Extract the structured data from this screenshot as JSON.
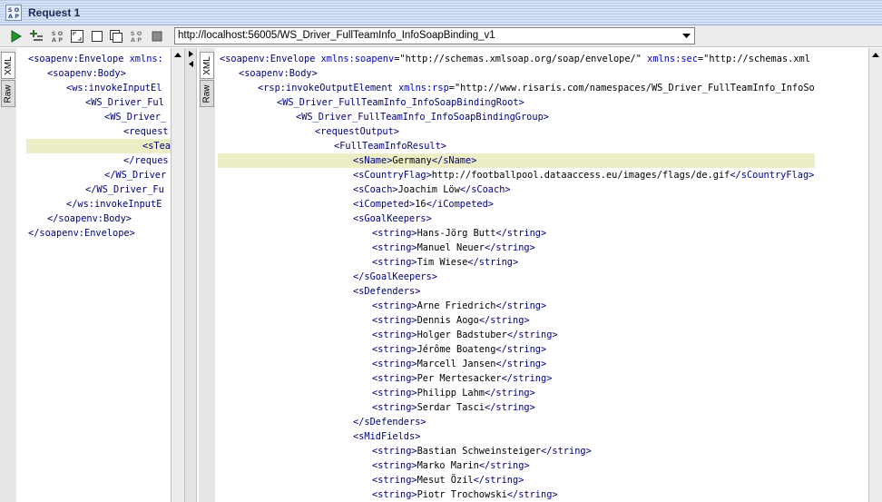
{
  "window": {
    "title": "Request 1",
    "title_icon": "soap-icon"
  },
  "toolbar": {
    "buttons": [
      "run-icon",
      "add-assertion-icon",
      "soap-icon",
      "fullscreen-icon",
      "split-horizontal-icon",
      "split-window-icon",
      "soap-icon",
      "stop-icon"
    ],
    "endpoint": "http://localhost:56005/WS_Driver_FullTeamInfo_InfoSoapBinding_v1"
  },
  "request_panel": {
    "tabs": [
      "XML",
      "Raw"
    ],
    "active_tab": "XML",
    "lines": [
      {
        "indent": 0,
        "parts": [
          {
            "c": "tag",
            "t": "<soapenv:Envelope "
          },
          {
            "c": "attr",
            "t": "xmlns:"
          }
        ]
      },
      {
        "indent": 1,
        "parts": [
          {
            "c": "tag",
            "t": "<soapenv:Body>"
          }
        ]
      },
      {
        "indent": 2,
        "parts": [
          {
            "c": "tag",
            "t": "<ws:invokeInputEl"
          }
        ]
      },
      {
        "indent": 3,
        "parts": [
          {
            "c": "tag",
            "t": "<WS_Driver_Ful"
          }
        ]
      },
      {
        "indent": 4,
        "parts": [
          {
            "c": "tag",
            "t": "<WS_Driver_"
          }
        ]
      },
      {
        "indent": 5,
        "parts": [
          {
            "c": "tag",
            "t": "<request"
          }
        ]
      },
      {
        "indent": 6,
        "hl": true,
        "parts": [
          {
            "c": "tag",
            "t": "<sTea"
          }
        ]
      },
      {
        "indent": 5,
        "parts": [
          {
            "c": "tag",
            "t": "</reques"
          }
        ]
      },
      {
        "indent": 4,
        "parts": [
          {
            "c": "tag",
            "t": "</WS_Driver"
          }
        ]
      },
      {
        "indent": 3,
        "parts": [
          {
            "c": "tag",
            "t": "</WS_Driver_Fu"
          }
        ]
      },
      {
        "indent": 2,
        "parts": [
          {
            "c": "tag",
            "t": "</ws:invokeInputE"
          }
        ]
      },
      {
        "indent": 1,
        "parts": [
          {
            "c": "tag",
            "t": "</soapenv:Body>"
          }
        ]
      },
      {
        "indent": 0,
        "parts": [
          {
            "c": "tag",
            "t": "</soapenv:Envelope>"
          }
        ]
      }
    ]
  },
  "response_panel": {
    "tabs": [
      "XML",
      "Raw"
    ],
    "active_tab": "XML",
    "lines": [
      {
        "indent": 0,
        "parts": [
          {
            "c": "tag",
            "t": "<soapenv:Envelope "
          },
          {
            "c": "attr",
            "t": "xmlns:soapenv"
          },
          {
            "c": "val",
            "t": "=\"http://schemas.xmlsoap.org/soap/envelope/\" "
          },
          {
            "c": "attr",
            "t": "xmlns:sec"
          },
          {
            "c": "val",
            "t": "=\"http://schemas.xml"
          }
        ]
      },
      {
        "indent": 1,
        "parts": [
          {
            "c": "tag",
            "t": "<soapenv:Body>"
          }
        ]
      },
      {
        "indent": 2,
        "parts": [
          {
            "c": "tag",
            "t": "<rsp:invokeOutputElement "
          },
          {
            "c": "attr",
            "t": "xmlns:rsp"
          },
          {
            "c": "val",
            "t": "=\"http://www.risaris.com/namespaces/WS_Driver_FullTeamInfo_InfoSo"
          }
        ]
      },
      {
        "indent": 3,
        "parts": [
          {
            "c": "tag",
            "t": "<WS_Driver_FullTeamInfo_InfoSoapBindingRoot>"
          }
        ]
      },
      {
        "indent": 4,
        "parts": [
          {
            "c": "tag",
            "t": "<WS_Driver_FullTeamInfo_InfoSoapBindingGroup>"
          }
        ]
      },
      {
        "indent": 5,
        "parts": [
          {
            "c": "tag",
            "t": "<requestOutput>"
          }
        ]
      },
      {
        "indent": 6,
        "parts": [
          {
            "c": "tag",
            "t": "<FullTeamInfoResult>"
          }
        ]
      },
      {
        "indent": 7,
        "hl": true,
        "parts": [
          {
            "c": "tag",
            "t": "<sName>"
          },
          {
            "c": "txt",
            "t": "Germany"
          },
          {
            "c": "tag",
            "t": "</sName>"
          }
        ]
      },
      {
        "indent": 7,
        "parts": [
          {
            "c": "tag",
            "t": "<sCountryFlag>"
          },
          {
            "c": "txt",
            "t": "http://footballpool.dataaccess.eu/images/flags/de.gif"
          },
          {
            "c": "tag",
            "t": "</sCountryFlag>"
          }
        ]
      },
      {
        "indent": 7,
        "parts": [
          {
            "c": "tag",
            "t": "<sCoach>"
          },
          {
            "c": "txt",
            "t": "Joachim Löw"
          },
          {
            "c": "tag",
            "t": "</sCoach>"
          }
        ]
      },
      {
        "indent": 7,
        "parts": [
          {
            "c": "tag",
            "t": "<iCompeted>"
          },
          {
            "c": "txt",
            "t": "16"
          },
          {
            "c": "tag",
            "t": "</iCompeted>"
          }
        ]
      },
      {
        "indent": 7,
        "parts": [
          {
            "c": "tag",
            "t": "<sGoalKeepers>"
          }
        ]
      },
      {
        "indent": 8,
        "parts": [
          {
            "c": "tag",
            "t": "<string>"
          },
          {
            "c": "txt",
            "t": "Hans-Jörg Butt"
          },
          {
            "c": "tag",
            "t": "</string>"
          }
        ]
      },
      {
        "indent": 8,
        "parts": [
          {
            "c": "tag",
            "t": "<string>"
          },
          {
            "c": "txt",
            "t": "Manuel Neuer"
          },
          {
            "c": "tag",
            "t": "</string>"
          }
        ]
      },
      {
        "indent": 8,
        "parts": [
          {
            "c": "tag",
            "t": "<string>"
          },
          {
            "c": "txt",
            "t": "Tim Wiese"
          },
          {
            "c": "tag",
            "t": "</string>"
          }
        ]
      },
      {
        "indent": 7,
        "parts": [
          {
            "c": "tag",
            "t": "</sGoalKeepers>"
          }
        ]
      },
      {
        "indent": 7,
        "parts": [
          {
            "c": "tag",
            "t": "<sDefenders>"
          }
        ]
      },
      {
        "indent": 8,
        "parts": [
          {
            "c": "tag",
            "t": "<string>"
          },
          {
            "c": "txt",
            "t": "Arne Friedrich"
          },
          {
            "c": "tag",
            "t": "</string>"
          }
        ]
      },
      {
        "indent": 8,
        "parts": [
          {
            "c": "tag",
            "t": "<string>"
          },
          {
            "c": "txt",
            "t": "Dennis Aogo"
          },
          {
            "c": "tag",
            "t": "</string>"
          }
        ]
      },
      {
        "indent": 8,
        "parts": [
          {
            "c": "tag",
            "t": "<string>"
          },
          {
            "c": "txt",
            "t": "Holger Badstuber"
          },
          {
            "c": "tag",
            "t": "</string>"
          }
        ]
      },
      {
        "indent": 8,
        "parts": [
          {
            "c": "tag",
            "t": "<string>"
          },
          {
            "c": "txt",
            "t": "Jérôme Boateng"
          },
          {
            "c": "tag",
            "t": "</string>"
          }
        ]
      },
      {
        "indent": 8,
        "parts": [
          {
            "c": "tag",
            "t": "<string>"
          },
          {
            "c": "txt",
            "t": "Marcell Jansen"
          },
          {
            "c": "tag",
            "t": "</string>"
          }
        ]
      },
      {
        "indent": 8,
        "parts": [
          {
            "c": "tag",
            "t": "<string>"
          },
          {
            "c": "txt",
            "t": "Per Mertesacker"
          },
          {
            "c": "tag",
            "t": "</string>"
          }
        ]
      },
      {
        "indent": 8,
        "parts": [
          {
            "c": "tag",
            "t": "<string>"
          },
          {
            "c": "txt",
            "t": "Philipp Lahm"
          },
          {
            "c": "tag",
            "t": "</string>"
          }
        ]
      },
      {
        "indent": 8,
        "parts": [
          {
            "c": "tag",
            "t": "<string>"
          },
          {
            "c": "txt",
            "t": "Serdar Tasci"
          },
          {
            "c": "tag",
            "t": "</string>"
          }
        ]
      },
      {
        "indent": 7,
        "parts": [
          {
            "c": "tag",
            "t": "</sDefenders>"
          }
        ]
      },
      {
        "indent": 7,
        "parts": [
          {
            "c": "tag",
            "t": "<sMidFields>"
          }
        ]
      },
      {
        "indent": 8,
        "parts": [
          {
            "c": "tag",
            "t": "<string>"
          },
          {
            "c": "txt",
            "t": "Bastian Schweinsteiger"
          },
          {
            "c": "tag",
            "t": "</string>"
          }
        ]
      },
      {
        "indent": 8,
        "parts": [
          {
            "c": "tag",
            "t": "<string>"
          },
          {
            "c": "txt",
            "t": "Marko Marin"
          },
          {
            "c": "tag",
            "t": "</string>"
          }
        ]
      },
      {
        "indent": 8,
        "parts": [
          {
            "c": "tag",
            "t": "<string>"
          },
          {
            "c": "txt",
            "t": "Mesut Özil"
          },
          {
            "c": "tag",
            "t": "</string>"
          }
        ]
      },
      {
        "indent": 8,
        "parts": [
          {
            "c": "tag",
            "t": "<string>"
          },
          {
            "c": "txt",
            "t": "Piotr Trochowski"
          },
          {
            "c": "tag",
            "t": "</string>"
          }
        ]
      }
    ]
  },
  "colors": {
    "tag": "#000080",
    "attr": "#0000c0",
    "highlight": "#ededc6"
  }
}
